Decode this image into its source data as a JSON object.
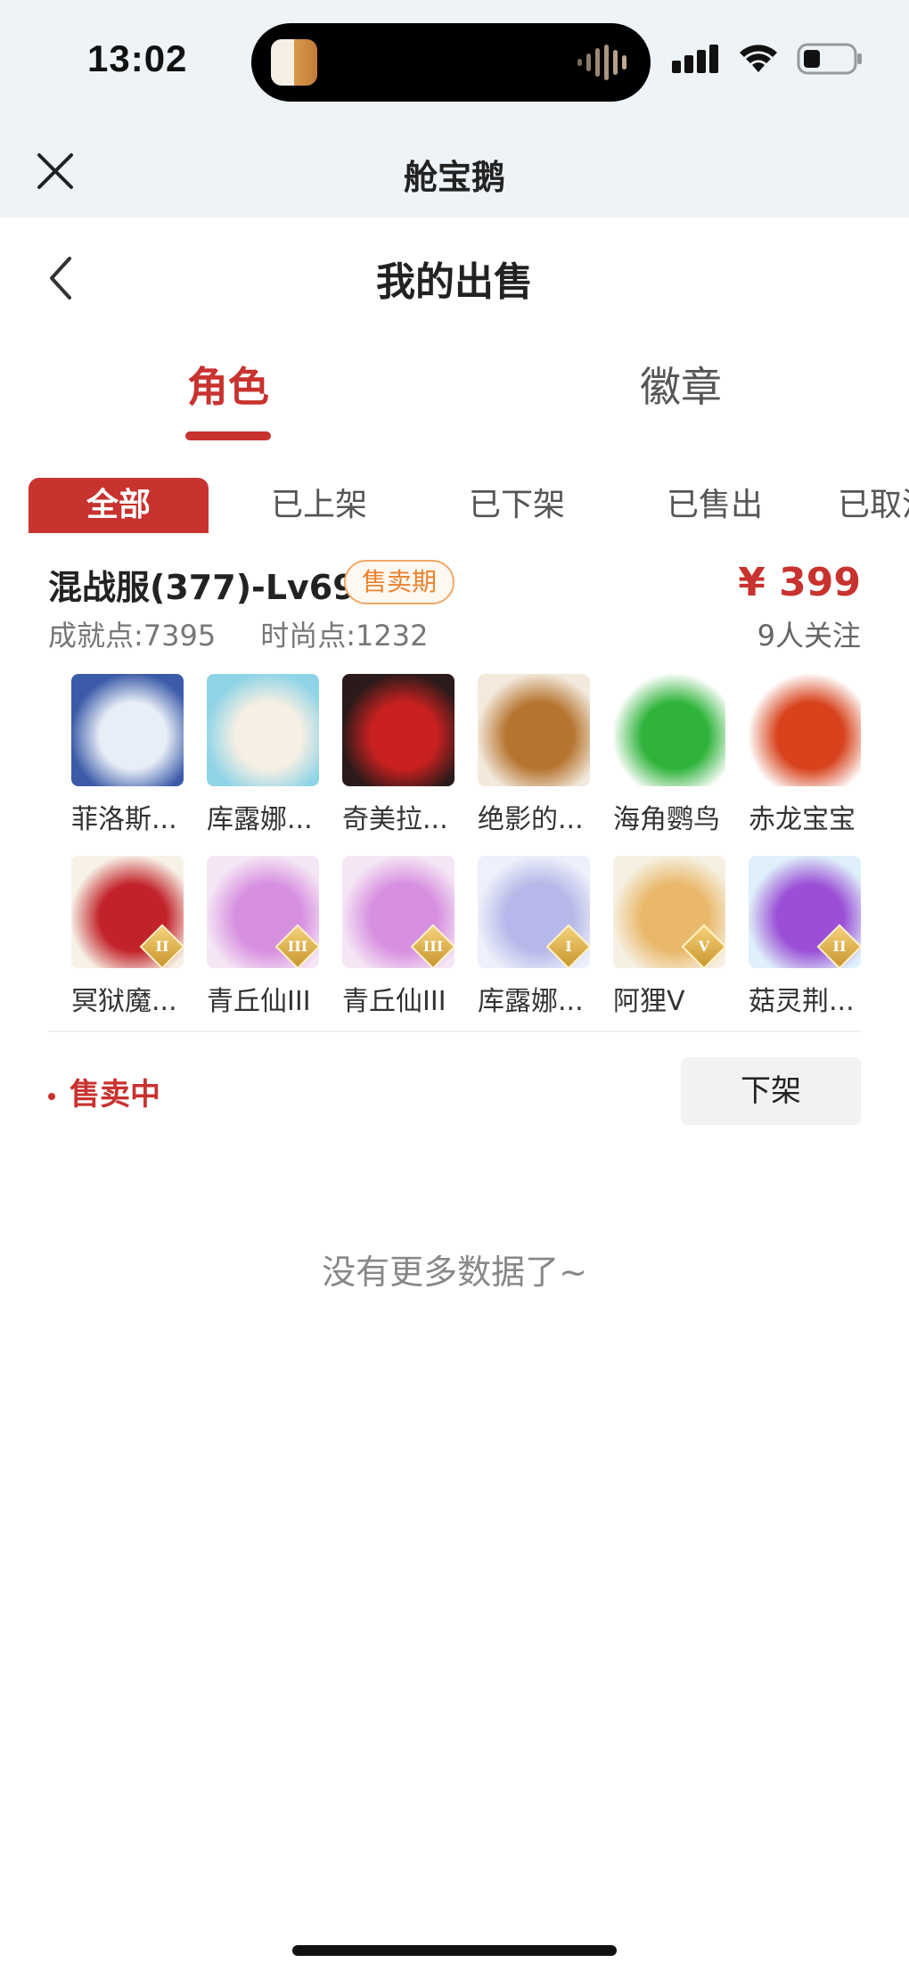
{
  "status_bar": {
    "time": "13:02"
  },
  "webview": {
    "title": "舱宝鹅"
  },
  "page": {
    "title": "我的出售"
  },
  "main_tabs": [
    {
      "label": "角色",
      "active": true
    },
    {
      "label": "徽章",
      "active": false
    }
  ],
  "filters": [
    {
      "label": "全部",
      "active": true
    },
    {
      "label": "已上架"
    },
    {
      "label": "已下架"
    },
    {
      "label": "已售出"
    },
    {
      "label": "已取消"
    }
  ],
  "listing": {
    "server": "混战服(377)-Lv69",
    "status_tag": "售卖期",
    "price": "¥ 399",
    "achievement": "成就点:7395",
    "fashion": "时尚点:1232",
    "followers": "9人关注",
    "pets": [
      {
        "name": "菲洛斯...",
        "colors": [
          "#3b5aa8",
          "#e8eef7"
        ],
        "rank": ""
      },
      {
        "name": "库露娜...",
        "colors": [
          "#8fd4e6",
          "#f6efe4"
        ],
        "rank": ""
      },
      {
        "name": "奇美拉...",
        "colors": [
          "#2a1a1a",
          "#c82020"
        ],
        "rank": ""
      },
      {
        "name": "绝影的...",
        "colors": [
          "#f3e9dc",
          "#b5742f"
        ],
        "rank": ""
      },
      {
        "name": "海角鹦鸟",
        "colors": [
          "#ffffff",
          "#2fb33a"
        ],
        "rank": ""
      },
      {
        "name": "赤龙宝宝",
        "colors": [
          "#ffffff",
          "#d8421c"
        ],
        "rank": ""
      },
      {
        "name": "冥狱魔...",
        "colors": [
          "#f7f1e6",
          "#c2232a"
        ],
        "rank": "II"
      },
      {
        "name": "青丘仙III",
        "colors": [
          "#f5e6f5",
          "#d78fe0"
        ],
        "rank": "III"
      },
      {
        "name": "青丘仙III",
        "colors": [
          "#f5e6f5",
          "#d78fe0"
        ],
        "rank": "III"
      },
      {
        "name": "库露娜...",
        "colors": [
          "#eef0fb",
          "#b5b8e8"
        ],
        "rank": "I"
      },
      {
        "name": "阿狸V",
        "colors": [
          "#f6f0e2",
          "#e9b86a"
        ],
        "rank": "V"
      },
      {
        "name": "菇灵荆...",
        "colors": [
          "#dff0fa",
          "#9a4fd6"
        ],
        "rank": "II"
      }
    ],
    "selling_label": "售卖中",
    "delist_button": "下架"
  },
  "footer": {
    "no_more": "没有更多数据了~"
  },
  "colors": {
    "accent": "#c8322f",
    "tag": "#e8822e"
  }
}
